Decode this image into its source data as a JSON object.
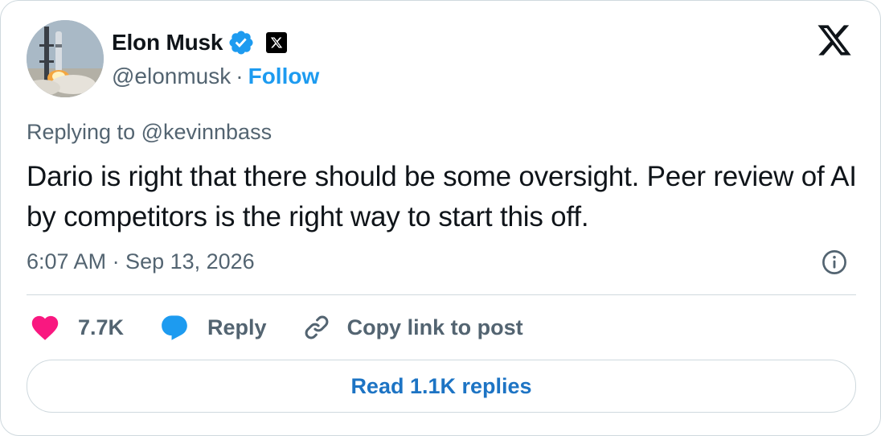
{
  "author": {
    "name": "Elon Musk",
    "handle": "@elonmusk",
    "separator": "·",
    "follow_label": "Follow",
    "affiliation_badge": "𝕏"
  },
  "tweet": {
    "replying_to": "Replying to @kevinnbass",
    "text": "Dario is right that there should be some oversight. Peer review of AI by competitors is the right way to start this off.",
    "timestamp": "6:07 AM · Sep 13, 2026"
  },
  "actions": {
    "likes_count": "7.7K",
    "reply_label": "Reply",
    "copy_link_label": "Copy link to post"
  },
  "read_replies_label": "Read 1.1K replies",
  "colors": {
    "accent": "#1d9bf0",
    "like": "#f91880",
    "text": "#0f1419",
    "secondary": "#536471",
    "border": "#cfd9de"
  },
  "icons": {
    "verified": "verified-badge-icon",
    "brand": "x-logo-icon",
    "info": "info-icon",
    "like": "heart-icon",
    "reply": "speech-bubble-icon",
    "copy": "link-icon"
  }
}
